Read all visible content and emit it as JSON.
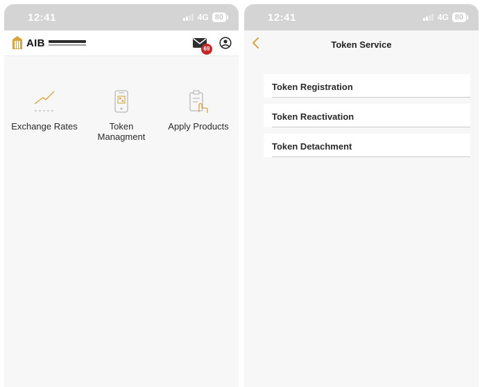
{
  "left_screen": {
    "status": {
      "time": "12:41",
      "network": "4G",
      "battery": "80"
    },
    "header": {
      "logo_text": "AIB",
      "unread_count": "69"
    },
    "services": [
      {
        "label": "Exchange Rates",
        "icon": "chart-line-icon"
      },
      {
        "label": "Token\nManagment",
        "icon": "token-device-icon"
      },
      {
        "label": "Apply Products",
        "icon": "clipboard-hand-icon"
      }
    ]
  },
  "right_screen": {
    "status": {
      "time": "12:41",
      "network": "4G",
      "battery": "80"
    },
    "header": {
      "title": "Token Service",
      "back_icon": "chevron-left-icon"
    },
    "items": [
      {
        "label": "Token Registration"
      },
      {
        "label": "Token Reactivation"
      },
      {
        "label": "Token Detachment"
      }
    ]
  },
  "colors": {
    "accent": "#d9a43a",
    "status_bar": "#d4d4d4",
    "badge": "#c62828",
    "background": "#f7f7f7"
  }
}
